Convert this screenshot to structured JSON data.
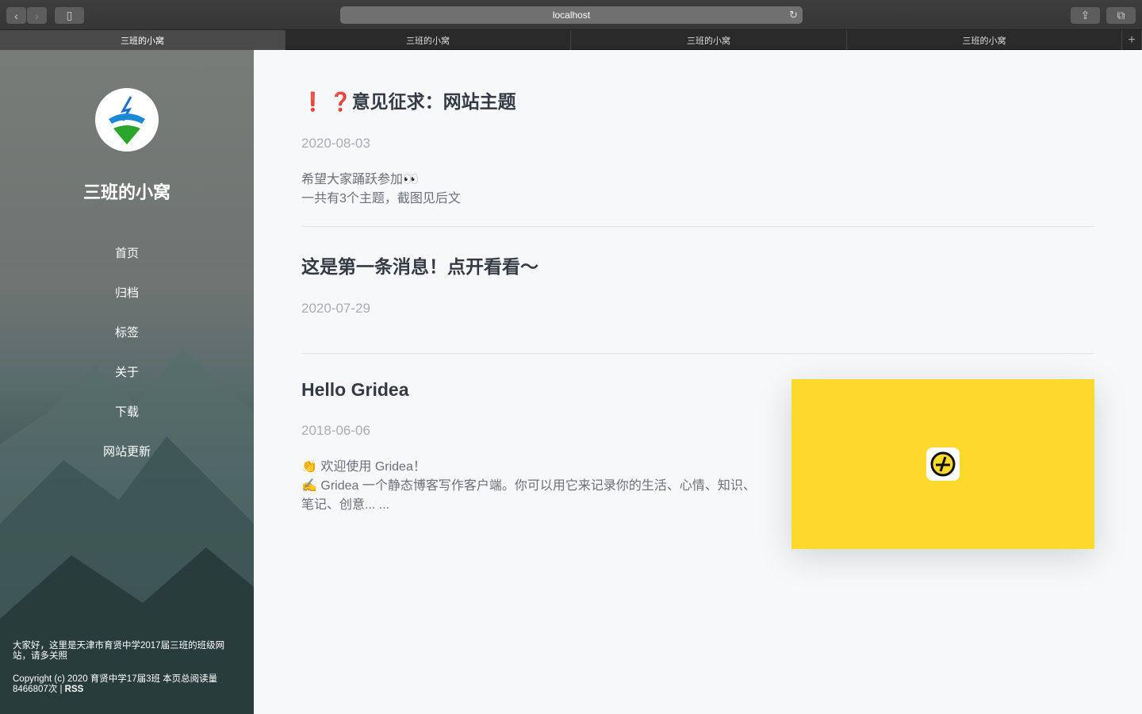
{
  "browser": {
    "url": "localhost",
    "tabs": [
      "三班的小窝",
      "三班的小窝",
      "三班的小窝",
      "三班的小窝"
    ],
    "new_tab": "+"
  },
  "sidebar": {
    "title": "三班的小窝",
    "nav": [
      "首页",
      "归档",
      "标签",
      "关于",
      "下载",
      "网站更新"
    ],
    "intro": "大家好，这里是天津市育贤中学2017届三班的班级网站，请多关照",
    "copyright": "Copyright (c) 2020 育贤中学17届3班 本页总阅读量8466807次 | ",
    "rss": "RSS"
  },
  "posts": [
    {
      "title": "❗ ❓意见征求：网站主题",
      "date": "2020-08-03",
      "lines": [
        "希望大家踊跃参加👀",
        "一共有3个主题，截图见后文"
      ]
    },
    {
      "title": "这是第一条消息！点开看看～",
      "date": "2020-07-29",
      "lines": []
    },
    {
      "title": "Hello Gridea",
      "date": "2018-06-06",
      "lines": [
        "👏 欢迎使用 Gridea！",
        "✍️ Gridea 一个静态博客写作客户端。你可以用它来记录你的生活、心情、知识、笔记、创意... ..."
      ]
    }
  ]
}
